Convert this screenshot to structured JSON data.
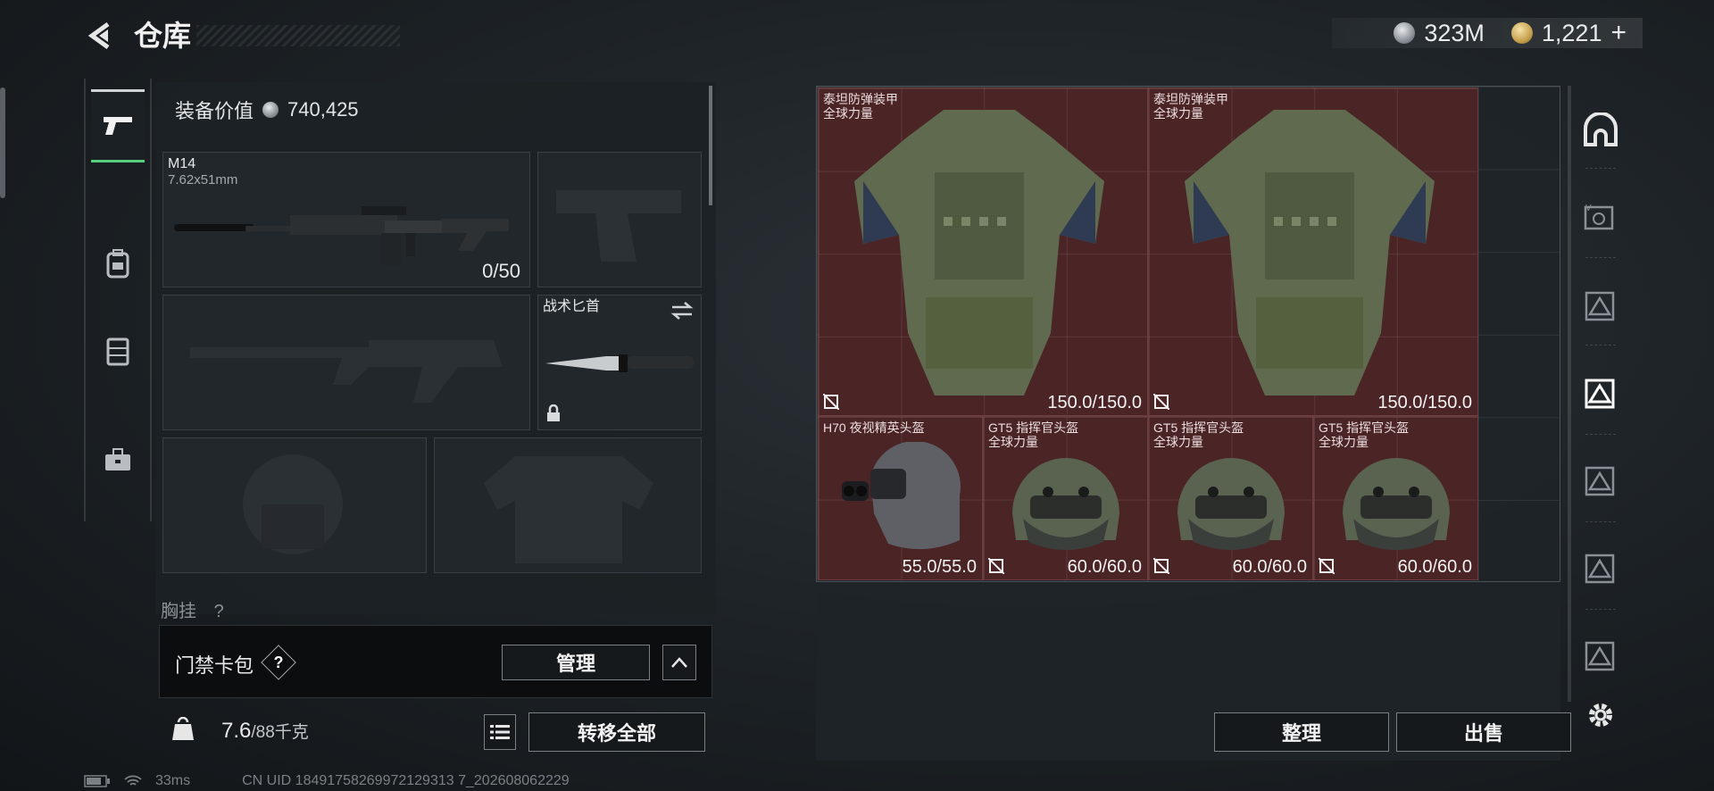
{
  "header": {
    "title": "仓库",
    "currency_silver": "323M",
    "currency_gold": "1,221",
    "gold_add": "+"
  },
  "equipment": {
    "value_label": "装备价值",
    "value": "740,425",
    "primary_weapon": {
      "name": "M14",
      "caliber": "7.62x51mm",
      "ammo": "0/50"
    },
    "melee": {
      "name": "战术匕首"
    },
    "chest_rig_label": "胸挂",
    "chest_rig_hint": "?"
  },
  "keycard": {
    "label": "门禁卡包",
    "help": "?",
    "manage": "管理"
  },
  "bottom": {
    "weight_current": "7.6",
    "weight_max": "/88千克",
    "transfer_all": "转移全部",
    "sort": "整理",
    "sell": "出售"
  },
  "status": {
    "ping": "33ms",
    "uid": "CN UID 18491758269972129313 7_202608062229"
  },
  "storage_items": [
    {
      "name": "泰坦防弹装甲",
      "sub": "全球力量",
      "durability": "150.0/150.0"
    },
    {
      "name": "泰坦防弹装甲",
      "sub": "全球力量",
      "durability": "150.0/150.0"
    },
    {
      "name": "H70 夜视精英头盔",
      "sub": "",
      "durability": "55.0/55.0"
    },
    {
      "name": "GT5 指挥官头盔",
      "sub": "全球力量",
      "durability": "60.0/60.0"
    },
    {
      "name": "GT5 指挥官头盔",
      "sub": "全球力量",
      "durability": "60.0/60.0"
    },
    {
      "name": "GT5 指挥官头盔",
      "sub": "全球力量",
      "durability": "60.0/60.0"
    }
  ],
  "colors": {
    "accent_green": "#56d07d",
    "item_bg_red": "#4b2426"
  },
  "icons": {
    "tabs": [
      "pistol-icon",
      "backpack-icon",
      "vest-icon",
      "toolbox-icon"
    ],
    "rail": [
      "helmet-category-icon",
      "armor-tier-v-icon",
      "armor-tier-iv-icon",
      "armor-tier-iii-icon",
      "armor-tier-iii-icon",
      "armor-tier-iv-icon",
      "armor-tier-iv-icon",
      "settings-icon"
    ]
  }
}
